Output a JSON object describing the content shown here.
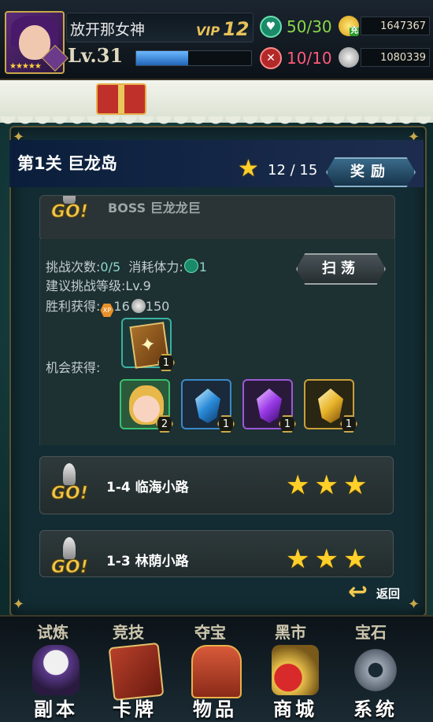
{
  "player": {
    "name": "放开那女神",
    "vip_label": "VIP",
    "vip_level": "12",
    "level_text": "Lv.31",
    "avatar_stars": "★★★★★",
    "exp_fraction": 0.45
  },
  "resources": {
    "stamina": "50/30",
    "pvp_energy": "10/10",
    "gold": "1647367",
    "silver": "1080339",
    "charge_label": "充"
  },
  "stage": {
    "title": "第1关 巨龙岛",
    "star_count": "12 / 15",
    "reward_button": "奖励"
  },
  "boss_row": {
    "name": "BOSS 巨龙龙巨"
  },
  "details": {
    "challenge_label": "挑战次数:",
    "challenge_value": "0/5",
    "stamina_cost_label": "消耗体力:",
    "stamina_cost_value": "1",
    "suggested_level": "建议挑战等级:Lv.9",
    "victory_label": "胜利获得:",
    "xp_label": "XP",
    "xp_value": "16",
    "silver_value": "150",
    "chance_label": "机会获得:",
    "sweep_button": "扫荡"
  },
  "drops": [
    {
      "name": "card-pack",
      "count": "1"
    },
    {
      "name": "elf-hero",
      "count": "2"
    },
    {
      "name": "blue-gem",
      "count": "1"
    },
    {
      "name": "purple-gem",
      "count": "1"
    },
    {
      "name": "gold-gem",
      "count": "1"
    }
  ],
  "stages": [
    {
      "id": "1-4",
      "name": "临海小路",
      "stars": "★★★",
      "go_label": "GO!"
    },
    {
      "id": "1-3",
      "name": "林荫小路",
      "stars": "★★★",
      "go_label": "GO!"
    }
  ],
  "back_button": "返回",
  "top_menu_hidden": [
    "试炼",
    "竞技",
    "夺宝",
    "黑市",
    "宝石"
  ],
  "bottom_menu": [
    {
      "label": "副本",
      "icon": "knight-icon"
    },
    {
      "label": "卡牌",
      "icon": "cards-icon"
    },
    {
      "label": "物品",
      "icon": "chest-icon"
    },
    {
      "label": "商城",
      "icon": "shop-icon"
    },
    {
      "label": "系统",
      "icon": "gear-icon"
    }
  ],
  "colors": {
    "panel_bg": "#132c33",
    "gold_accent": "#c9a84a",
    "star_yellow": "#ffcf2a",
    "stamina_green": "#8ad84a",
    "pvp_pink": "#ff5a7a"
  }
}
